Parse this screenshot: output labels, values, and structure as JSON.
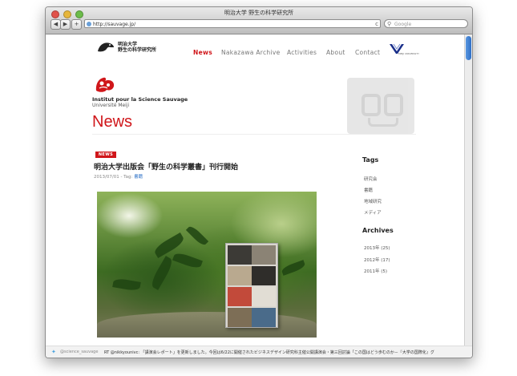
{
  "browser": {
    "window_title": "明治大学 野生の科学研究所",
    "url": "http://sauvage.jp/",
    "search_placeholder": "Google",
    "back_label": "◀",
    "forward_label": "▶",
    "add_label": "+",
    "reload_label": "c"
  },
  "site": {
    "logo_text_line1": "明治大学",
    "logo_text_line2": "野生の科学研究所",
    "nav": [
      {
        "label": "News"
      },
      {
        "label": "Nakazawa Archive"
      },
      {
        "label": "Activities"
      },
      {
        "label": "About"
      },
      {
        "label": "Contact"
      }
    ],
    "uni_logo_small_text": "MEIJI UNIVERSITY",
    "institute_name": "Institut pour la Science Sauvage",
    "institute_sub": "Université Meiji",
    "page_title": "News"
  },
  "post": {
    "badge": "NEWS",
    "title": "明治大学出版会「野生の科学叢書」刊行開始",
    "meta_prefix": "2013/07/01 - Tag: ",
    "meta_tag": "書籍"
  },
  "sidebar": {
    "tags_heading": "Tags",
    "tags": [
      "研究会",
      "書籍",
      "地域研究",
      "メディア"
    ],
    "archives_heading": "Archives",
    "archives": [
      "2013年 (25)",
      "2012年 (17)",
      "2011年 (5)"
    ]
  },
  "tweet": {
    "handle": "@science_sauvage",
    "text": "RT @nikkyounivc: 「講演会レポート」を更新しました。今回は6/22に開催されたビジネスデザイン研究科主催公開講演会・第三回討論「この国はどう歩むのか－『大学の国際化』グ"
  },
  "colors": {
    "accent": "#d0161a",
    "link": "#2a6fc6"
  }
}
